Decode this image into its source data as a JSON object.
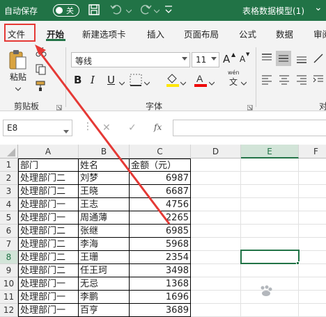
{
  "titlebar": {
    "autosave_label": "自动保存",
    "toggle_state": "关",
    "doc_title": "表格数据模型(1)",
    "dropdown_glyph": "⌄"
  },
  "tabs": [
    "文件",
    "开始",
    "新建选项卡",
    "插入",
    "页面布局",
    "公式",
    "数据",
    "审阅"
  ],
  "ribbon": {
    "paste_label": "粘贴",
    "clipboard_group": "剪贴板",
    "font_name": "等线",
    "font_size": "11",
    "font_group": "字体",
    "align_group_partial": "对",
    "bold": "B",
    "italic": "I",
    "underline": "U",
    "grow_font": "A",
    "shrink_font": "A",
    "phonetic": "wén"
  },
  "formula_bar": {
    "name_box": "E8",
    "fx_label": "fx",
    "cancel_glyph": "✕",
    "enter_glyph": "✓",
    "value": ""
  },
  "sheet": {
    "columns": [
      "A",
      "B",
      "C",
      "D",
      "E",
      "F"
    ],
    "selected_column": "E",
    "selected_row": "8",
    "rows": [
      {
        "n": "1",
        "a": "部门",
        "b": "姓名",
        "c": "金额（元）"
      },
      {
        "n": "2",
        "a": "处理部门二",
        "b": "刘梦",
        "c": "6987"
      },
      {
        "n": "3",
        "a": "处理部门二",
        "b": "王晓",
        "c": "6687"
      },
      {
        "n": "4",
        "a": "处理部门一",
        "b": "王志",
        "c": "4756"
      },
      {
        "n": "5",
        "a": "处理部门一",
        "b": "周通薄",
        "c": "2265"
      },
      {
        "n": "6",
        "a": "处理部门二",
        "b": "张继",
        "c": "6985"
      },
      {
        "n": "7",
        "a": "处理部门二",
        "b": "李海",
        "c": "5968"
      },
      {
        "n": "8",
        "a": "处理部门二",
        "b": "王珊",
        "c": "2354"
      },
      {
        "n": "9",
        "a": "处理部门二",
        "b": "任王珂",
        "c": "3498"
      },
      {
        "n": "10",
        "a": "处理部门一",
        "b": "无忌",
        "c": "1368"
      },
      {
        "n": "11",
        "a": "处理部门一",
        "b": "李鹏",
        "c": "1696"
      },
      {
        "n": "12",
        "a": "处理部门一",
        "b": "百亨",
        "c": "3689"
      }
    ]
  },
  "colors": {
    "excel_green": "#217346",
    "annotation_red": "#e53935"
  }
}
